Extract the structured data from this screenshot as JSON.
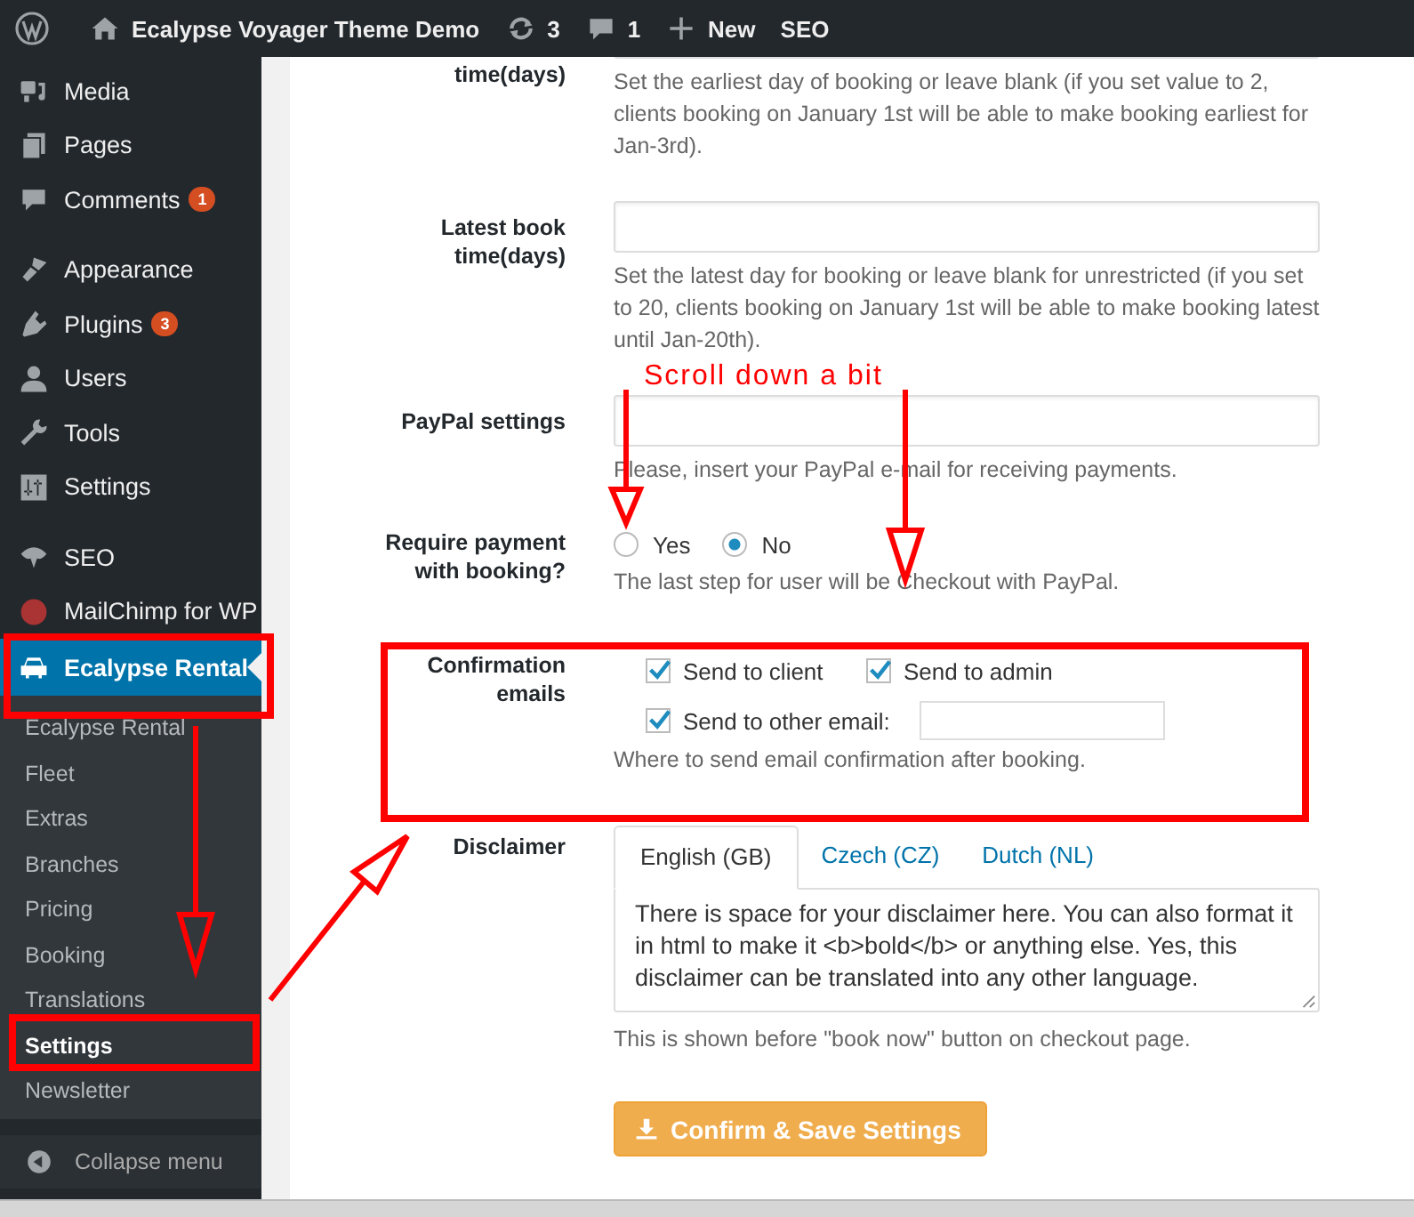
{
  "admin_bar": {
    "site_title": "Ecalypse Voyager Theme Demo",
    "updates": "3",
    "comments": "1",
    "new": "New",
    "seo": "SEO"
  },
  "sidebar": {
    "groups": [
      [
        {
          "label": "Media",
          "selected": false
        },
        {
          "label": "Pages",
          "selected": false
        },
        {
          "label": "Comments",
          "badge": "1",
          "selected": false
        }
      ],
      [
        {
          "label": "Appearance",
          "selected": false
        },
        {
          "label": "Plugins",
          "badge": "3",
          "selected": false
        },
        {
          "label": "Users",
          "selected": false
        },
        {
          "label": "Tools",
          "selected": false
        },
        {
          "label": "Settings",
          "selected": false
        }
      ],
      [
        {
          "label": "SEO",
          "selected": false
        },
        {
          "label": "MailChimp for WP",
          "selected": false
        },
        {
          "label": "Ecalypse Rental",
          "selected": true,
          "children": [
            {
              "label": "Ecalypse Rental",
              "selected": false
            },
            {
              "label": "Fleet",
              "selected": false
            },
            {
              "label": "Extras",
              "selected": false
            },
            {
              "label": "Branches",
              "selected": false
            },
            {
              "label": "Pricing",
              "selected": false
            },
            {
              "label": "Booking",
              "selected": false
            },
            {
              "label": "Translations",
              "selected": false
            },
            {
              "label": "Settings",
              "selected": true
            },
            {
              "label": "Newsletter",
              "selected": false
            }
          ]
        }
      ]
    ],
    "collapse": "Collapse menu"
  },
  "form": {
    "rows": [
      {
        "kind": "field",
        "label": "time(days)",
        "description": "Set the earliest day of booking or leave blank (if you set value to 2, clients booking on January 1st will be able to make booking earliest for Jan-3rd)."
      },
      {
        "kind": "field",
        "label": "Latest book time(days)",
        "description": "Set the latest day for booking or leave blank for unrestricted (if you set to 20, clients booking on January 1st will be able to make booking latest until Jan-20th)."
      },
      {
        "kind": "field",
        "label": "PayPal settings",
        "description": "Please, insert your PayPal e-mail for receiving payments."
      },
      {
        "kind": "radio",
        "label": "Require payment with booking?",
        "options": [
          {
            "label": "Yes",
            "selected": false
          },
          {
            "label": "No",
            "selected": true
          }
        ],
        "description": "The last step for user will be Checkout with PayPal."
      },
      {
        "kind": "checkboxes",
        "label": "Confirmation emails",
        "options": [
          {
            "label": "Send to client",
            "checked": true
          },
          {
            "label": "Send to admin",
            "checked": true
          },
          {
            "label": "Send to other email:",
            "checked": true
          }
        ],
        "description": "Where to send email confirmation after booking."
      },
      {
        "kind": "tabs",
        "label": "Disclaimer",
        "tabs": [
          {
            "label": "English (GB)",
            "selected": true
          },
          {
            "label": "Czech (CZ)",
            "selected": false
          },
          {
            "label": "Dutch (NL)",
            "selected": false
          }
        ],
        "value": "There is space for your disclaimer here. You can also format it in html to make it <b>bold</b> or anything else. Yes, this disclaimer can be translated into any other language.",
        "description": "This is shown before \"book now\" button on checkout page."
      }
    ],
    "submit": "Confirm & Save Settings"
  },
  "annotation": {
    "note": "Scroll down a bit"
  }
}
